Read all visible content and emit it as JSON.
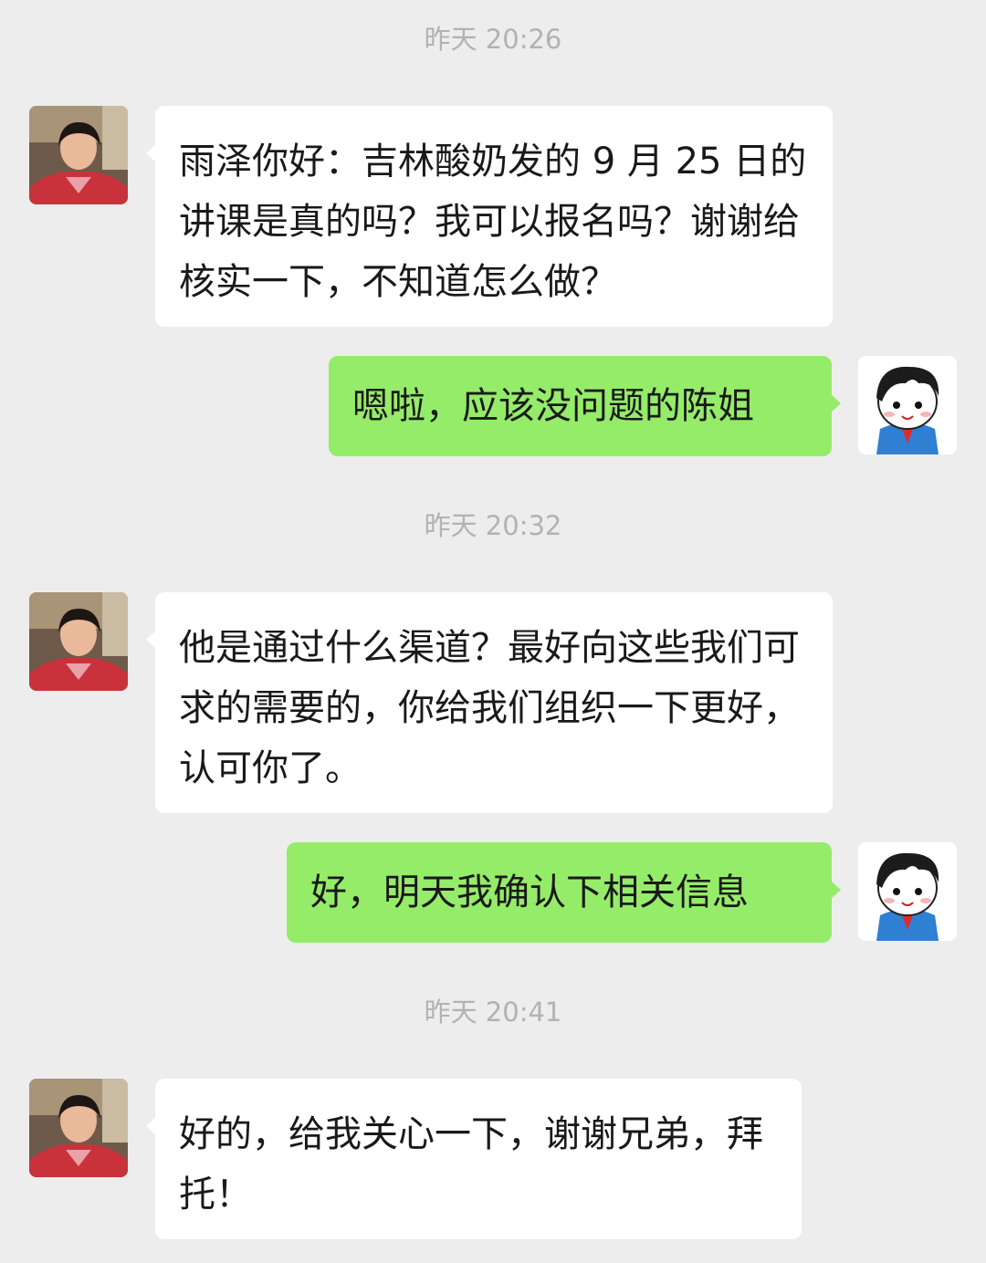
{
  "messages": [
    {
      "type": "timestamp",
      "text": "昨天 20:26"
    },
    {
      "type": "incoming",
      "text": "雨泽你好：吉林酸奶发的 9 月 25 日的讲课是真的吗？我可以报名吗？谢谢给核实一下，不知道怎么做？"
    },
    {
      "type": "outgoing",
      "text": "嗯啦，应该没问题的陈姐"
    },
    {
      "type": "timestamp",
      "text": "昨天 20:32"
    },
    {
      "type": "incoming",
      "text": "他是通过什么渠道？最好向这些我们可求的需要的，你给我们组织一下更好，认可你了。"
    },
    {
      "type": "outgoing",
      "text": "好，明天我确认下相关信息"
    },
    {
      "type": "timestamp",
      "text": "昨天 20:41"
    },
    {
      "type": "incoming",
      "text": "好的，给我关心一下，谢谢兄弟，拜托！"
    }
  ],
  "avatars": {
    "contact": "contact-avatar-photo",
    "self": "cartoon-boy-avatar"
  },
  "colors": {
    "background": "#ededed",
    "incoming_bubble": "#ffffff",
    "outgoing_bubble": "#95ec69",
    "timestamp_text": "#b2b2b2",
    "message_text": "#191919"
  }
}
